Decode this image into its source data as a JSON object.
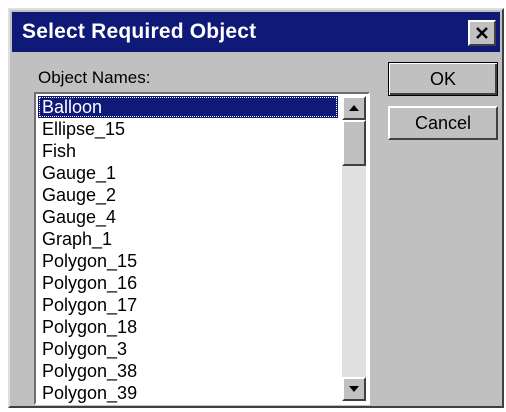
{
  "dialog": {
    "title": "Select Required Object",
    "close_glyph": "✕",
    "list_label": "Object Names:",
    "items": [
      "Balloon",
      "Ellipse_15",
      "Fish",
      "Gauge_1",
      "Gauge_2",
      "Gauge_4",
      "Graph_1",
      "Polygon_15",
      "Polygon_16",
      "Polygon_17",
      "Polygon_18",
      "Polygon_3",
      "Polygon_38",
      "Polygon_39"
    ],
    "selected_item": "Balloon",
    "ok_label": "OK",
    "cancel_label": "Cancel"
  },
  "colors": {
    "titlebar": "#0f1a78",
    "selection": "#0f1a78",
    "face": "#c0c0c0"
  },
  "icons": {
    "close": "close-icon",
    "scroll_up": "scroll-up-arrow-icon",
    "scroll_down": "scroll-down-arrow-icon"
  }
}
